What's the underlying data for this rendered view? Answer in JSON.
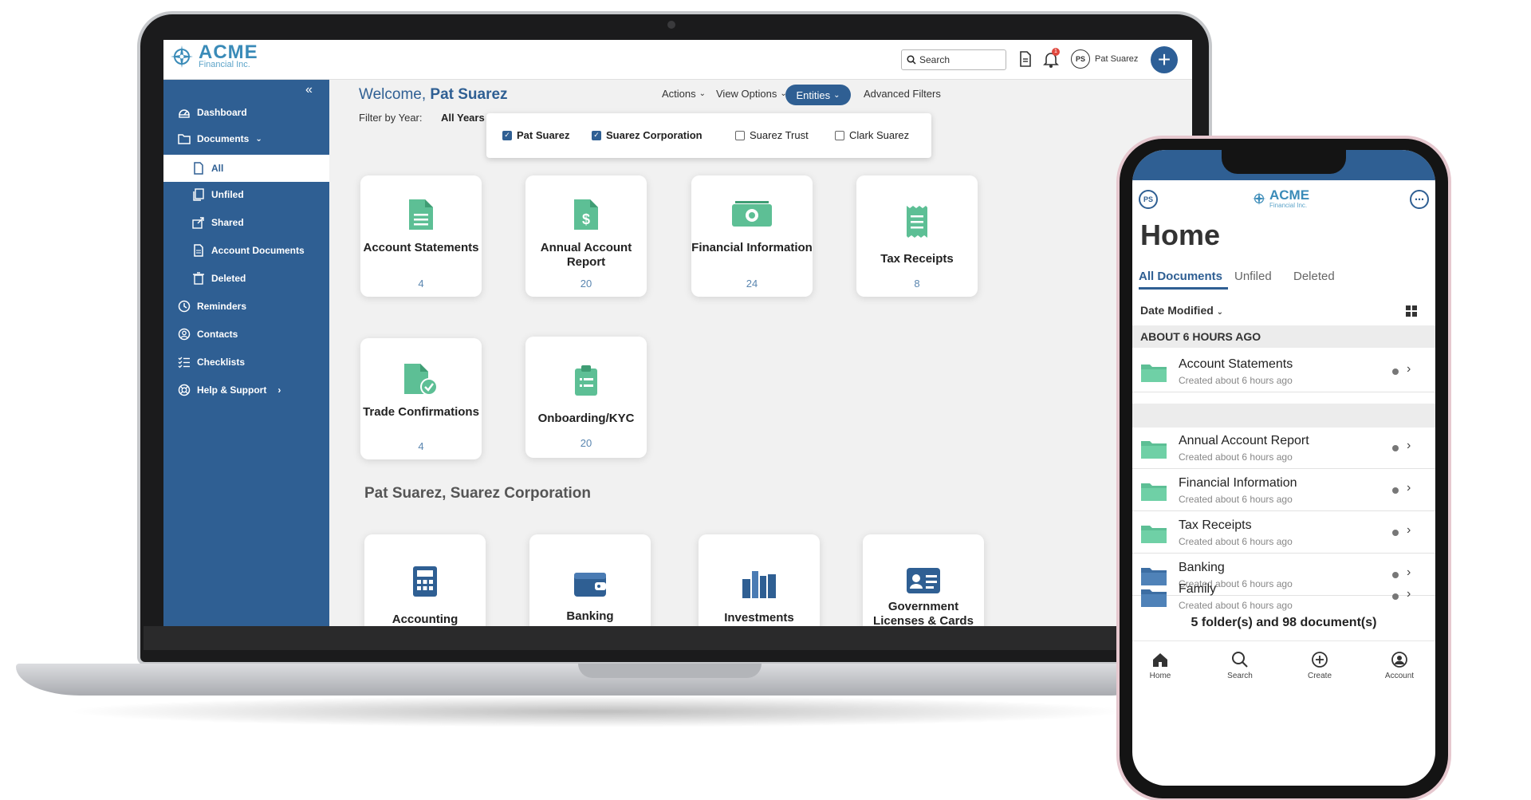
{
  "desktop": {
    "logo": {
      "brand": "ACME",
      "sub": "Financial Inc."
    },
    "search_placeholder": "Search",
    "notification_badge": "1",
    "user": {
      "initials": "PS",
      "name": "Pat Suarez"
    },
    "sidebar": {
      "collapse": "«",
      "items": [
        {
          "label": "Dashboard",
          "icon": "dashboard-icon"
        },
        {
          "label": "Documents",
          "icon": "folder-icon",
          "expanded": true
        },
        {
          "label": "All",
          "icon": "document-icon",
          "active": true
        },
        {
          "label": "Unfiled",
          "icon": "copy-icon"
        },
        {
          "label": "Shared",
          "icon": "share-icon"
        },
        {
          "label": "Account Documents",
          "icon": "document-icon"
        },
        {
          "label": "Deleted",
          "icon": "trash-icon"
        },
        {
          "label": "Reminders",
          "icon": "clock-icon"
        },
        {
          "label": "Contacts",
          "icon": "contact-icon"
        },
        {
          "label": "Checklists",
          "icon": "checklist-icon"
        },
        {
          "label": "Help & Support",
          "icon": "help-icon"
        }
      ]
    },
    "welcome_prefix": "Welcome, ",
    "welcome_name": "Pat Suarez",
    "filter_label": "Filter by Year:",
    "filter_value": "All Years",
    "toolbar": {
      "actions": "Actions",
      "view_options": "View Options",
      "entities": "Entities",
      "advanced_filters": "Advanced Filters"
    },
    "entities_dropdown": [
      {
        "label": "Pat Suarez",
        "checked": true
      },
      {
        "label": "Suarez Corporation",
        "checked": true
      },
      {
        "label": "Suarez Trust",
        "checked": false
      },
      {
        "label": "Clark Suarez",
        "checked": false
      }
    ],
    "cards_row1": [
      {
        "title": "Account Statements",
        "count": "4"
      },
      {
        "title": "Annual Account Report",
        "count": "20"
      },
      {
        "title": "Financial Information",
        "count": "24"
      },
      {
        "title": "Tax Receipts",
        "count": "8"
      }
    ],
    "cards_row2": [
      {
        "title": "Trade Confirmations",
        "count": "4"
      },
      {
        "title": "Onboarding/KYC",
        "count": "20"
      }
    ],
    "section_title": "Pat Suarez, Suarez Corporation",
    "cards_row3": [
      {
        "title": "Accounting"
      },
      {
        "title": "Banking"
      },
      {
        "title": "Investments"
      },
      {
        "title": "Government Licenses & Cards"
      }
    ],
    "colors": {
      "primary": "#2f5f93",
      "accent_green": "#5dbf95",
      "brand_blue": "#3a8bb8"
    }
  },
  "mobile": {
    "initials": "PS",
    "logo": {
      "brand": "ACME",
      "sub": "Financial Inc."
    },
    "title": "Home",
    "tabs": [
      "All Documents",
      "Unfiled",
      "Deleted"
    ],
    "sort": "Date Modified",
    "section": "ABOUT 6 HOURS AGO",
    "items": [
      {
        "name": "Account Statements",
        "meta": "Created about 6 hours ago",
        "color": "green"
      },
      {
        "name": "Annual Account Report",
        "meta": "Created about 6 hours ago",
        "color": "green"
      },
      {
        "name": "Financial Information",
        "meta": "Created about 6 hours ago",
        "color": "green"
      },
      {
        "name": "Tax Receipts",
        "meta": "Created about 6 hours ago",
        "color": "green"
      },
      {
        "name": "Banking",
        "meta": "Created about 6 hours ago",
        "color": "blue"
      },
      {
        "name": "Family",
        "meta": "Created about 6 hours ago",
        "color": "blue"
      }
    ],
    "summary": "5 folder(s) and 98 document(s)",
    "bottom_nav": [
      "Home",
      "Search",
      "Create",
      "Account"
    ]
  }
}
